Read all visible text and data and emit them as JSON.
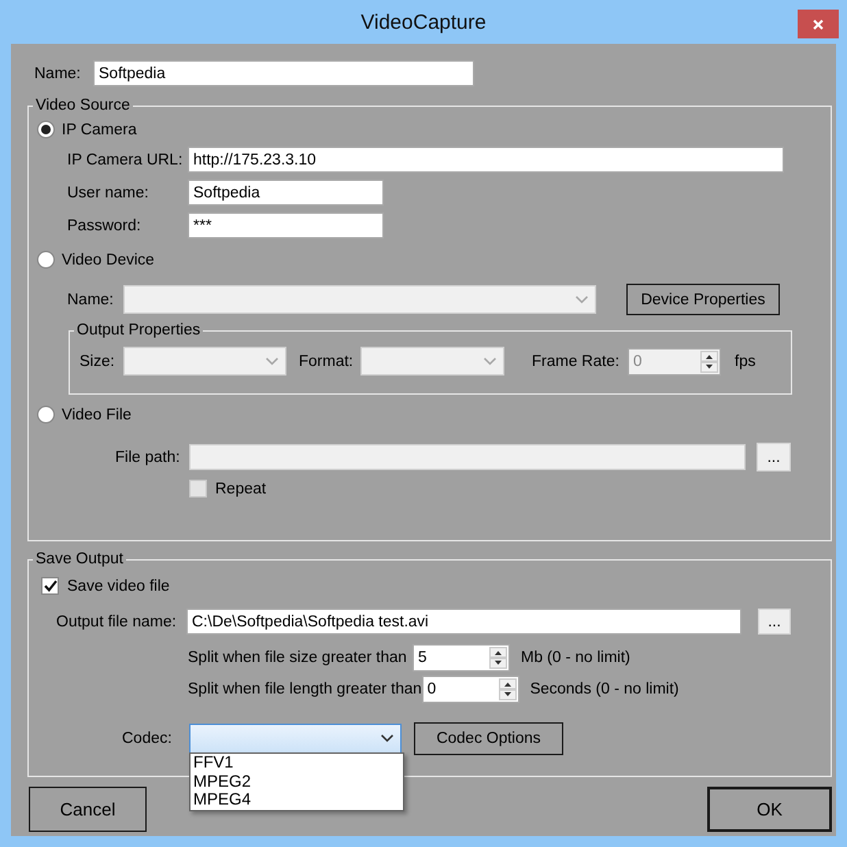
{
  "window": {
    "title": "VideoCapture"
  },
  "name_field": {
    "label": "Name:",
    "value": "Softpedia"
  },
  "video_source": {
    "title": "Video Source",
    "options": [
      {
        "kind": "ip_camera",
        "label": "IP Camera",
        "selected": true,
        "fields": [
          {
            "label": "IP Camera URL:",
            "value": "http://175.23.3.10"
          },
          {
            "label": "User name:",
            "value": "Softpedia"
          },
          {
            "label": "Password:",
            "value": "***"
          }
        ]
      },
      {
        "kind": "video_device",
        "label": "Video Device",
        "selected": false,
        "name_label": "Name:",
        "properties_button": "Device Properties",
        "output_properties": {
          "title": "Output Properties",
          "size_label": "Size:",
          "format_label": "Format:",
          "frame_rate_label": "Frame Rate:",
          "frame_rate": "0",
          "unit": "fps"
        }
      },
      {
        "kind": "video_file",
        "label": "Video File",
        "selected": false,
        "file_path_label": "File path:",
        "browse_button": "...",
        "repeat": {
          "label": "Repeat",
          "checked": false
        }
      }
    ]
  },
  "save_output": {
    "title": "Save Output",
    "save_video_file": {
      "label": "Save video file",
      "checked": true
    },
    "output_file": {
      "label": "Output file name:",
      "value": "C:\\De\\Softpedia\\Softpedia test.avi",
      "browse_button": "..."
    },
    "split_size": {
      "label": "Split when file size greater than",
      "value": "5",
      "unit": "Mb (0 - no limit)"
    },
    "split_length": {
      "label": "Split when file length greater than",
      "value": "0",
      "unit": "Seconds (0 - no limit)"
    },
    "codec": {
      "label": "Codec:",
      "expanded": true,
      "options": [
        "FFV1",
        "MPEG2",
        "MPEG4"
      ]
    },
    "codec_options_button": "Codec Options"
  },
  "buttons": [
    {
      "label": "Cancel",
      "default": false
    },
    {
      "label": "OK",
      "default": true
    }
  ]
}
